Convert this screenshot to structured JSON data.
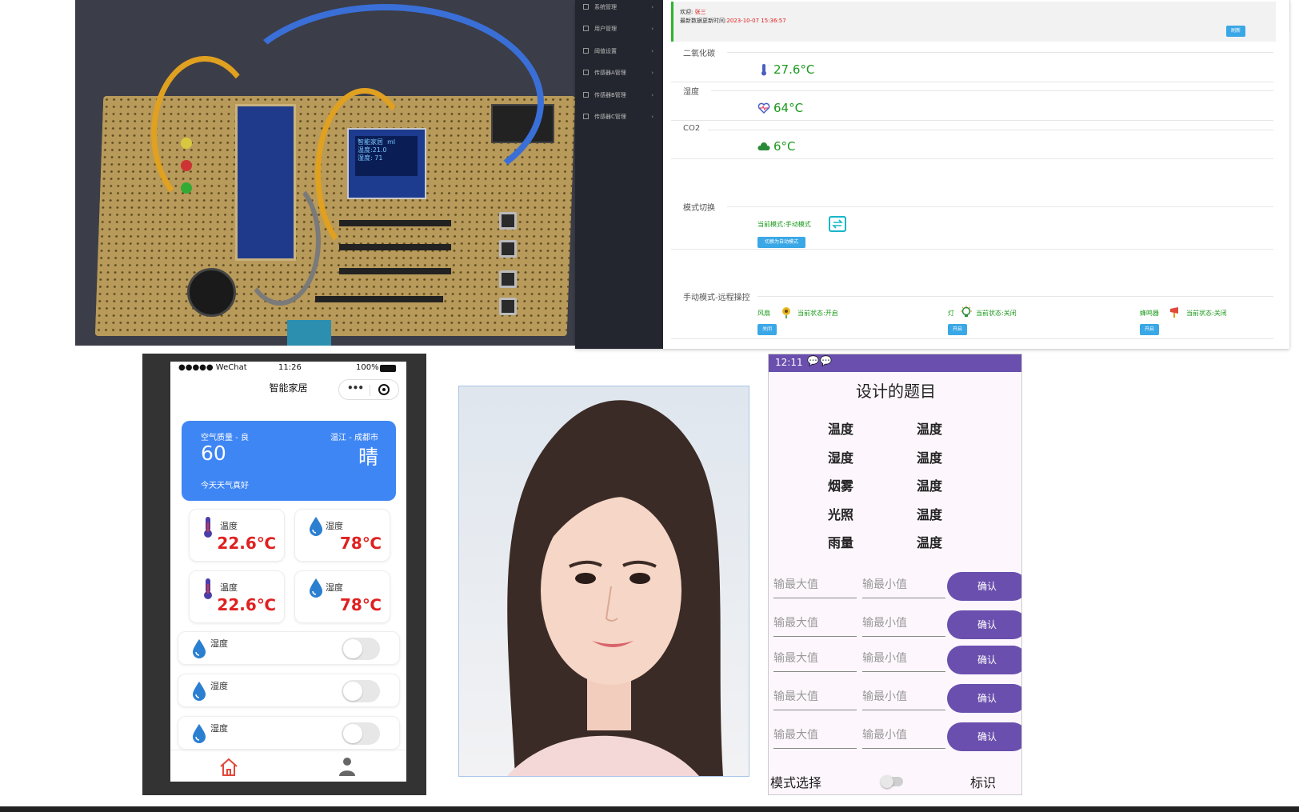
{
  "hardware_photo": {
    "oled_text": "智能家居  ml\n温度:21.0\n湿度: 71"
  },
  "admin": {
    "sidebar": [
      {
        "label": "系统管理"
      },
      {
        "label": "用户管理"
      },
      {
        "label": "阈值设置"
      },
      {
        "label": "传感器A管理"
      },
      {
        "label": "传感器B管理"
      },
      {
        "label": "传感器C管理"
      }
    ],
    "welcome_label": "欢迎:",
    "welcome_user": "张三",
    "update_label": "最新数据更新时间:",
    "update_time": "2023-10-07 15:36:57",
    "refresh_button": "刷新",
    "sections": {
      "co2_cn": "二氧化碳",
      "humidity": "湿度",
      "co2": "CO2",
      "mode_switch": "模式切换",
      "remote": "手动模式-远程操控"
    },
    "readings": {
      "r1": "27.6°C",
      "r2": "64°C",
      "r3": "6°C"
    },
    "mode": {
      "current_label": "当前模式:",
      "current_value": "手动模式",
      "switch_button": "切换为自动模式"
    },
    "devices": [
      {
        "name": "风扇",
        "status_label": "当前状态:",
        "status": "开启",
        "button": "关闭"
      },
      {
        "name": "灯",
        "status_label": "当前状态:",
        "status": "关闭",
        "button": "开启"
      },
      {
        "name": "蜂鸣器",
        "status_label": "当前状态:",
        "status": "关闭",
        "button": "开启"
      }
    ]
  },
  "wechat": {
    "status_left": "●●●●● WeChat",
    "status_time": "11:26",
    "status_battery": "100%",
    "title": "智能家居",
    "weather": {
      "aqi_label": "空气质量 - 良",
      "aqi_value": "60",
      "location": "温江 - 成都市",
      "condition": "晴",
      "note": "今天天气真好"
    },
    "cards": [
      {
        "label": "温度",
        "value": "22.6℃",
        "icon": "thermometer-icon"
      },
      {
        "label": "湿度",
        "value": "78℃",
        "icon": "water-drop-icon"
      },
      {
        "label": "温度",
        "value": "22.6℃",
        "icon": "thermometer-icon"
      },
      {
        "label": "湿度",
        "value": "78℃",
        "icon": "water-drop-icon"
      }
    ],
    "switches": [
      {
        "label": "湿度",
        "on": false
      },
      {
        "label": "湿度",
        "on": false
      },
      {
        "label": "湿度",
        "on": false
      }
    ],
    "tabs": [
      "home-icon",
      "user-icon"
    ]
  },
  "android": {
    "status_time": "12:11",
    "title": "设计的题目",
    "grid": [
      [
        "温度",
        "温度"
      ],
      [
        "湿度",
        "温度"
      ],
      [
        "烟雾",
        "温度"
      ],
      [
        "光照",
        "温度"
      ],
      [
        "雨量",
        "温度"
      ]
    ],
    "max_placeholder": "输最大值",
    "min_placeholder": "输最小值",
    "confirm": "确认",
    "mode_label": "模式选择",
    "flag_label": "标识"
  },
  "colors": {
    "admin_green": "#1a9a1a",
    "admin_blue": "#3aa7e6",
    "wechat_blue": "#3f86f5",
    "wechat_red": "#e02020",
    "android_purple": "#6a4fae"
  }
}
